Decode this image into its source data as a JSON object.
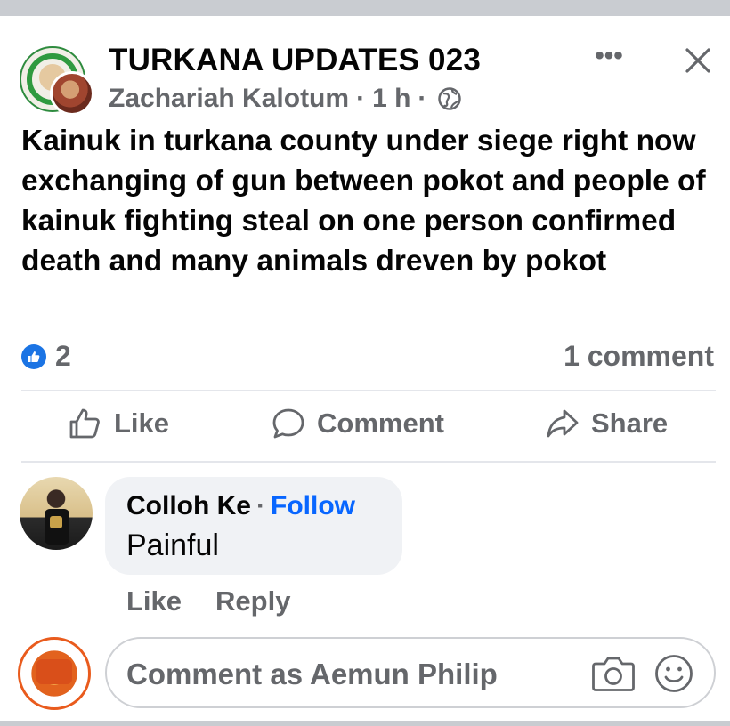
{
  "post": {
    "group_name": "TURKANA UPDATES 023",
    "author": "Zachariah Kalotum",
    "time": "1 h",
    "separator": "·",
    "privacy_icon": "globe-icon",
    "text": "Kainuk in turkana county under siege right now exchanging of gun between pokot and people of kainuk fighting steal on one person confirmed death and many animals dreven by pokot",
    "more_label": "•••"
  },
  "stats": {
    "reaction_icon": "like-badge-icon",
    "reaction_count": "2",
    "comment_count": "1 comment"
  },
  "actions": {
    "like": "Like",
    "comment": "Comment",
    "share": "Share"
  },
  "comment": {
    "author": "Colloh Ke",
    "separator": "·",
    "follow": "Follow",
    "text": "Painful",
    "like": "Like",
    "reply": "Reply"
  },
  "composer": {
    "placeholder": "Comment as Aemun Philip"
  },
  "colors": {
    "accent_blue": "#0866ff",
    "like_badge": "#1b74e4",
    "muted_text": "#65676b",
    "bubble_bg": "#f0f2f5"
  }
}
